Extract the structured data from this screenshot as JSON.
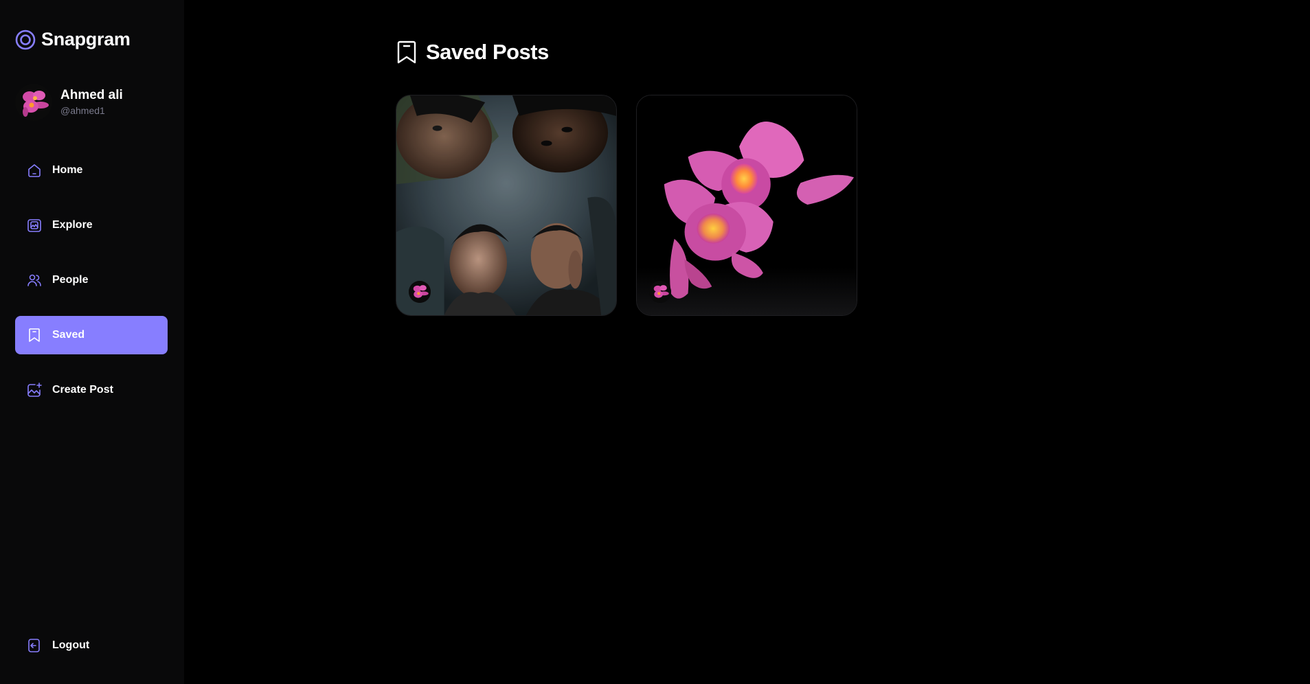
{
  "app": {
    "name": "Snapgram",
    "accent_color": "#877eff",
    "logo_icon": "snapgram-logo-icon"
  },
  "user": {
    "name": "Ahmed ali",
    "handle": "@ahmed1",
    "avatar_icon": "orchid-avatar"
  },
  "sidebar": {
    "items": [
      {
        "label": "Home",
        "icon": "home-icon",
        "active": false
      },
      {
        "label": "Explore",
        "icon": "explore-icon",
        "active": false
      },
      {
        "label": "People",
        "icon": "people-icon",
        "active": false
      },
      {
        "label": "Saved",
        "icon": "bookmark-icon",
        "active": true
      },
      {
        "label": "Create Post",
        "icon": "create-post-icon",
        "active": false
      }
    ],
    "logout": {
      "label": "Logout",
      "icon": "logout-icon"
    }
  },
  "main": {
    "title": "Saved Posts",
    "title_icon": "bookmark-icon",
    "posts": [
      {
        "image": "group-selfie-photo",
        "author_icon": "orchid-avatar"
      },
      {
        "image": "pink-orchid-photo",
        "author_icon": "orchid-avatar"
      }
    ]
  }
}
